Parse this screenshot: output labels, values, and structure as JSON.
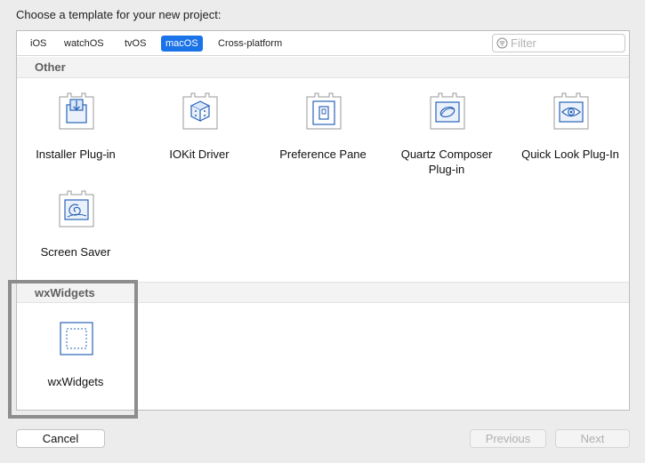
{
  "dialog": {
    "heading": "Choose a template for your new project:"
  },
  "toolbar": {
    "tabs": [
      "iOS",
      "watchOS",
      "tvOS",
      "macOS",
      "Cross-platform"
    ],
    "selected_tab": "macOS",
    "filter_placeholder": "Filter",
    "filter_value": ""
  },
  "sections": [
    {
      "title": "Other",
      "templates": [
        {
          "label": "Installer Plug-in",
          "icon": "installer-plugin-icon"
        },
        {
          "label": "IOKit Driver",
          "icon": "iokit-driver-icon"
        },
        {
          "label": "Preference Pane",
          "icon": "preference-pane-icon"
        },
        {
          "label": "Quartz Composer Plug-in",
          "icon": "quartz-composer-icon"
        },
        {
          "label": "Quick Look Plug-In",
          "icon": "quick-look-icon"
        },
        {
          "label": "Screen Saver",
          "icon": "screen-saver-icon"
        }
      ]
    },
    {
      "title": "wxWidgets",
      "templates": [
        {
          "label": "wxWidgets",
          "icon": "wxwidgets-template-icon",
          "selected": true
        }
      ]
    }
  ],
  "buttons": {
    "cancel": "Cancel",
    "previous": "Previous",
    "next": "Next"
  },
  "colors": {
    "accent": "#1a73e8",
    "icon_stroke": "#2a63b8",
    "highlight_border": "#8d8d8d"
  }
}
